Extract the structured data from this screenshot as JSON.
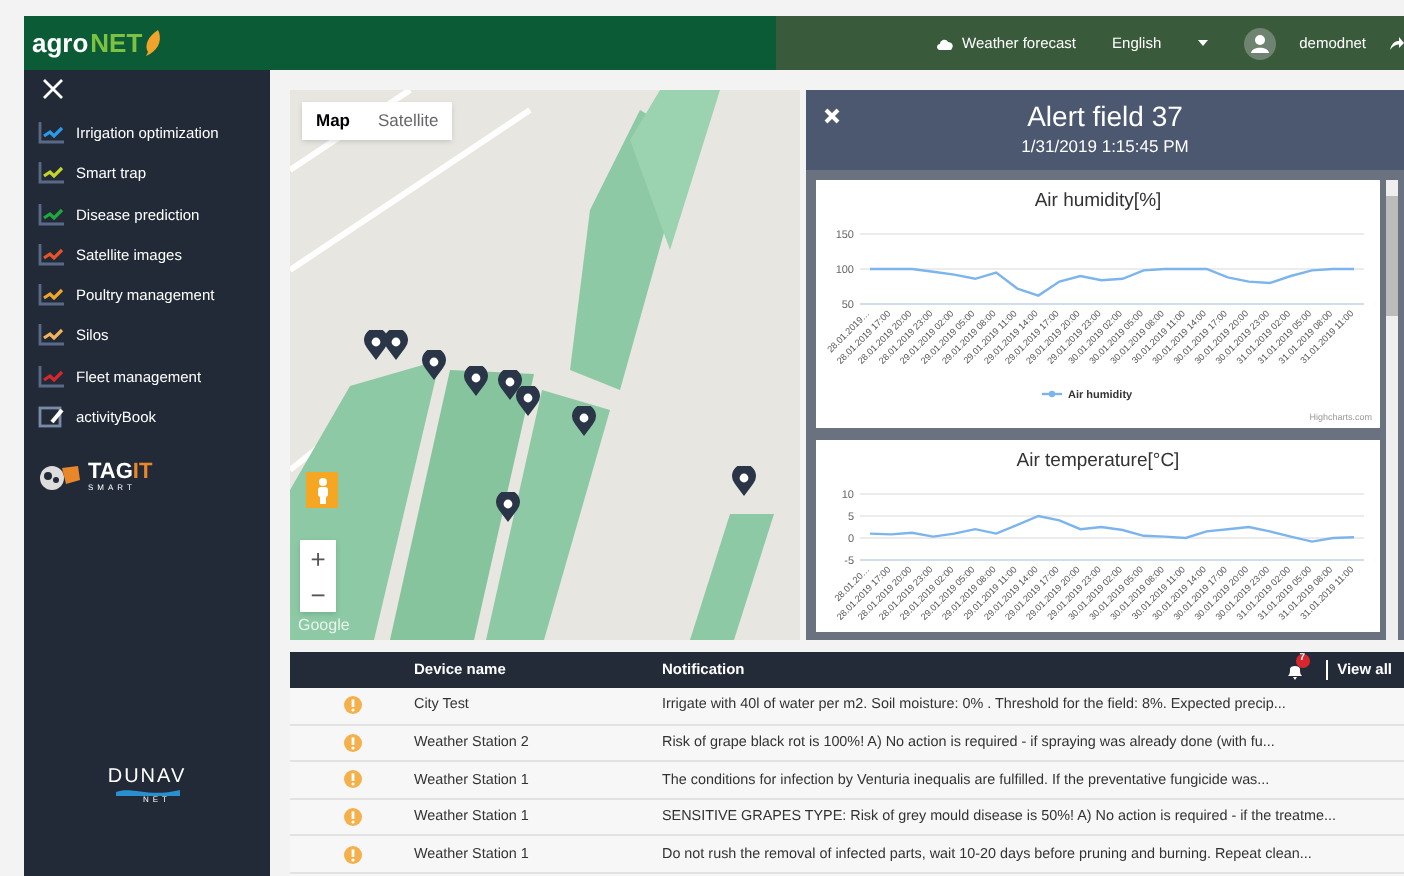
{
  "header": {
    "logo": {
      "part_1": "agro",
      "part_2": "NET"
    },
    "weather_link": "Weather forecast",
    "language": "English",
    "username": "demodnet"
  },
  "sidebar": {
    "items": [
      {
        "label": "Irrigation optimization",
        "kind": "chart",
        "color": "#2b9be8"
      },
      {
        "label": "Smart trap",
        "kind": "chart",
        "color": "#c6d32a"
      },
      {
        "label": "Disease prediction",
        "kind": "chart",
        "color": "#1fa83c"
      },
      {
        "label": "Satellite images",
        "kind": "chart",
        "color": "#e8542a"
      },
      {
        "label": "Poultry management",
        "kind": "chart",
        "color": "#f0a42a"
      },
      {
        "label": "Silos",
        "kind": "chart",
        "color": "#f2b35a"
      },
      {
        "label": "Fleet management",
        "kind": "chart",
        "color": "#d8262e"
      },
      {
        "label": "activityBook",
        "kind": "book"
      }
    ],
    "partner_logo": {
      "part_1": "TAG",
      "part_2": "IT",
      "subtitle": "SMART"
    },
    "footer_logo": {
      "title": "DUNAV",
      "subtitle": "NET"
    }
  },
  "map": {
    "tabs": [
      {
        "label": "Map",
        "selected": true
      },
      {
        "label": "Satellite",
        "selected": false
      }
    ],
    "zoom_in": "+",
    "zoom_out": "−",
    "attribution": "Google"
  },
  "alert": {
    "title": "Alert field 37",
    "timestamp": "1/31/2019 1:15:45 PM",
    "charts": [
      {
        "credit": "Highcharts.com",
        "chart_data": {
          "type": "line",
          "title": "Air humidity[%]",
          "categories": [
            "28.01.2019…",
            "28.01.2019 17:00",
            "28.01.2019 20:00",
            "28.01.2019 23:00",
            "29.01.2019 02:00",
            "29.01.2019 05:00",
            "29.01.2019 08:00",
            "29.01.2019 11:00",
            "29.01.2019 14:00",
            "29.01.2019 17:00",
            "29.01.2019 20:00",
            "29.01.2019 23:00",
            "30.01.2019 02:00",
            "30.01.2019 05:00",
            "30.01.2019 08:00",
            "30.01.2019 11:00",
            "30.01.2019 14:00",
            "30.01.2019 17:00",
            "30.01.2019 20:00",
            "30.01.2019 23:00",
            "31.01.2019 02:00",
            "31.01.2019 05:00",
            "31.01.2019 08:00",
            "31.01.2019 11:00"
          ],
          "ylim": [
            50,
            150
          ],
          "yticks": [
            50,
            100,
            150
          ],
          "series": [
            {
              "name": "Air humidity",
              "color": "#7cb5ec",
              "values": [
                100,
                100,
                100,
                96,
                92,
                86,
                95,
                72,
                62,
                82,
                90,
                84,
                86,
                98,
                100,
                100,
                100,
                88,
                82,
                80,
                90,
                98,
                100,
                100
              ]
            }
          ]
        }
      },
      {
        "chart_data": {
          "type": "line",
          "title": "Air temperature[°C]",
          "categories": [
            "28.01.20…",
            "28.01.2019 17:00",
            "28.01.2019 20:00",
            "28.01.2019 23:00",
            "29.01.2019 02:00",
            "29.01.2019 05:00",
            "29.01.2019 08:00",
            "29.01.2019 11:00",
            "29.01.2019 14:00",
            "29.01.2019 17:00",
            "29.01.2019 20:00",
            "29.01.2019 23:00",
            "30.01.2019 02:00",
            "30.01.2019 05:00",
            "30.01.2019 08:00",
            "30.01.2019 11:00",
            "30.01.2019 14:00",
            "30.01.2019 17:00",
            "30.01.2019 20:00",
            "30.01.2019 23:00",
            "31.01.2019 02:00",
            "31.01.2019 05:00",
            "31.01.2019 08:00",
            "31.01.2019 11:00"
          ],
          "ylim": [
            -5,
            10
          ],
          "yticks": [
            -5,
            0,
            5,
            10
          ],
          "series": [
            {
              "color": "#7cb5ec",
              "values": [
                1,
                0.8,
                1.2,
                0.3,
                1,
                2,
                1,
                3,
                5,
                4,
                2,
                2.5,
                1.8,
                0.5,
                0.3,
                0,
                1.5,
                2,
                2.5,
                1.5,
                0.3,
                -0.8,
                0,
                0.2
              ]
            }
          ]
        }
      }
    ]
  },
  "notifications": {
    "columns": [
      "Device name",
      "Notification"
    ],
    "badge": "7",
    "view_all": "View all",
    "rows": [
      {
        "device": "City Test",
        "text": "Irrigate with 40l of water per m2. Soil moisture: 0% . Threshold for the field: 8%. Expected precip..."
      },
      {
        "device": "Weather Station 2",
        "text": "Risk of grape black rot is 100%! A) No action is required - if spraying was already done (with fu..."
      },
      {
        "device": "Weather Station 1",
        "text": "The conditions for infection by Venturia inequalis are fulfilled. If the preventative fungicide was..."
      },
      {
        "device": "Weather Station 1",
        "text": "SENSITIVE GRAPES TYPE: Risk of grey mould disease is 50%! A) No action is required - if the treatme..."
      },
      {
        "device": "Weather Station 1",
        "text": "Do not rush the removal of infected parts, wait 10-20 days before pruning and burning. Repeat clean..."
      }
    ]
  }
}
